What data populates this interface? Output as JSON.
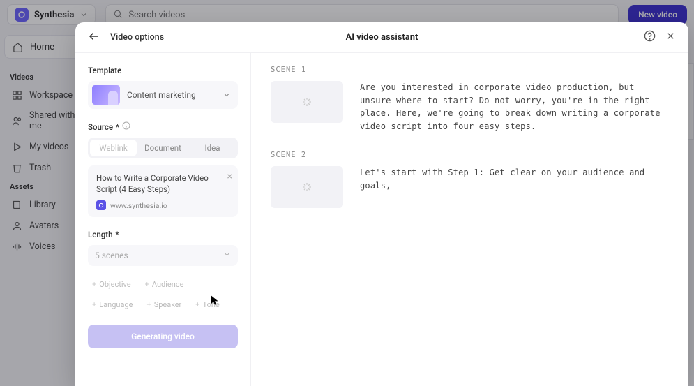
{
  "app": {
    "name": "Synthesia",
    "search_placeholder": "Search videos",
    "new_video": "New video"
  },
  "sidebar": {
    "home": "Home",
    "sections": {
      "videos": {
        "label": "Videos",
        "items": [
          "Workspace",
          "Shared with me",
          "My videos",
          "Trash"
        ]
      },
      "assets": {
        "label": "Assets",
        "items": [
          "Library",
          "Avatars",
          "Voices"
        ]
      }
    }
  },
  "modal": {
    "video_options": "Video options",
    "title": "AI video assistant",
    "template_label": "Template",
    "template_name": "Content marketing",
    "source_label": "Source",
    "source_tabs": [
      "Weblink",
      "Document",
      "Idea"
    ],
    "source_card": {
      "title": "How to Write a Corporate Video Script (4 Easy Steps)",
      "domain": "www.synthesia.io"
    },
    "length_label": "Length",
    "length_value": "5 scenes",
    "chips": [
      "Objective",
      "Audience",
      "Language",
      "Speaker",
      "Tone"
    ],
    "generate": "Generating video"
  },
  "scenes": [
    {
      "label": "SCENE 1",
      "text": "Are you interested in corporate video production, but unsure where to start? Do not worry, you're in the right place. Here, we're going to break down writing a corporate video script into four easy steps."
    },
    {
      "label": "SCENE 2",
      "text": "Let's start with Step 1: Get clear on your audience and goals,"
    }
  ]
}
